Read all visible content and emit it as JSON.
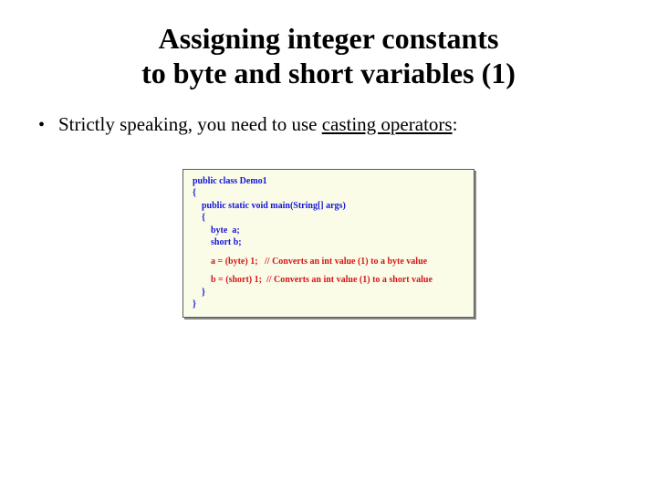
{
  "title_line1": "Assigning integer constants",
  "title_line2": "to byte and short variables (1)",
  "bullet": {
    "prefix": "Strictly speaking, you need to use ",
    "underlined": "casting operators",
    "suffix": ":"
  },
  "code": {
    "l1": "public class Demo1",
    "l2": "{",
    "l3": "    public static void main(String[] args)",
    "l4": "    {",
    "l5": "        byte  a;",
    "l6": "        short b;",
    "l7": "        a = (byte) 1;   // Converts an int value (1) to a byte value",
    "l8": "        b = (short) 1;  // Converts an int value (1) to a short value",
    "l9": "    }",
    "l10": "}"
  }
}
